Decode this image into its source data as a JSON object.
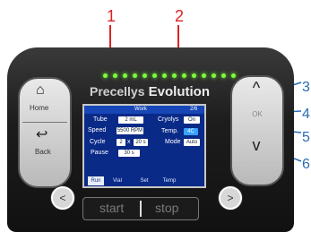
{
  "callouts": {
    "red": [
      "1",
      "2"
    ],
    "blue": [
      "3",
      "4",
      "5",
      "6"
    ]
  },
  "brand": {
    "title_part1": "Precellys",
    "title_part2": " Evolution"
  },
  "screen": {
    "title": "Work",
    "right_title": "2/6",
    "rows": [
      {
        "label": "Tube",
        "value": "2 mL"
      },
      {
        "label": "Speed",
        "value": "5500 RPM"
      },
      {
        "label": "Cycle",
        "value": "2",
        "value2": "20 s"
      },
      {
        "label": "Pause",
        "value": "30 s"
      }
    ],
    "right_rows": [
      {
        "label": "Cryolys",
        "value": "On"
      },
      {
        "label": "Temp.",
        "value": "4C"
      },
      {
        "label": "Mode",
        "value": "Auto"
      }
    ],
    "icon_bar": [
      {
        "name": "run-icon",
        "label": "Run"
      },
      {
        "name": "tube-icon",
        "label": "Vial"
      },
      {
        "name": "settings-icon",
        "label": "Set"
      },
      {
        "name": "snowflake-icon",
        "label": "Temp"
      }
    ]
  },
  "buttons": {
    "home": "Home",
    "back": "Back",
    "ok": "OK",
    "start": "start",
    "stop": "stop",
    "up_symbol": "^",
    "down_symbol": "v",
    "left_symbol": "<",
    "right_symbol": ">"
  }
}
